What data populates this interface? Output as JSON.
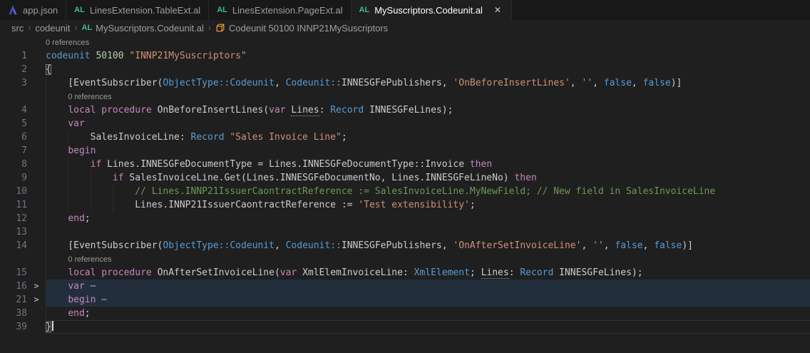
{
  "icons": {
    "al_badge_text": "AL",
    "close_glyph": "✕",
    "chevron_glyph": "›",
    "fold_chevron_glyph": ">"
  },
  "tabs": [
    {
      "label": "app.json",
      "icon": "app-json-icon",
      "active": false
    },
    {
      "label": "LinesExtension.TableExt.al",
      "icon": "al-file-icon",
      "active": false
    },
    {
      "label": "LinesExtension.PageExt.al",
      "icon": "al-file-icon",
      "active": false
    },
    {
      "label": "MySuscriptors.Codeunit.al",
      "icon": "al-file-icon",
      "active": true,
      "close_label": "✕"
    }
  ],
  "breadcrumb": {
    "separator": "›",
    "items": [
      {
        "label": "src"
      },
      {
        "label": "codeunit"
      },
      {
        "label": "MySuscriptors.Codeunit.al",
        "icon": "al-file-icon"
      },
      {
        "label": "Codeunit 50100 INNP21MySuscriptors",
        "icon": "symbol-class-icon"
      }
    ]
  },
  "editor": {
    "codelens_text": "0 references",
    "fold_marker": "⋯",
    "rows": [
      {
        "lens": true,
        "ind": 0
      },
      {
        "n": "1",
        "ind": 0,
        "t": [
          [
            "codeunit",
            "kw"
          ],
          [
            " ",
            "id"
          ],
          [
            "50100",
            "num"
          ],
          [
            " ",
            "id"
          ],
          [
            "\"INNP21MySuscriptors\"",
            "str"
          ]
        ]
      },
      {
        "n": "2",
        "ind": 0,
        "t": [
          [
            "{",
            "bm"
          ]
        ]
      },
      {
        "n": "3",
        "ind": 4,
        "t": [
          [
            "[EventSubscriber(",
            "id"
          ],
          [
            "ObjectType",
            "kw"
          ],
          [
            "::",
            "kw"
          ],
          [
            "Codeunit",
            "kw"
          ],
          [
            ", ",
            "id"
          ],
          [
            "Codeunit",
            "kw"
          ],
          [
            "::",
            "kw"
          ],
          [
            "INNESGFePublishers",
            "id"
          ],
          [
            ", ",
            "id"
          ],
          [
            "'OnBeforeInsertLines'",
            "str"
          ],
          [
            ", ",
            "id"
          ],
          [
            "''",
            "str"
          ],
          [
            ", ",
            "id"
          ],
          [
            "false",
            "kw"
          ],
          [
            ", ",
            "id"
          ],
          [
            "false",
            "kw"
          ],
          [
            ")]",
            "id"
          ]
        ]
      },
      {
        "lens": true,
        "ind": 4
      },
      {
        "n": "4",
        "ind": 4,
        "t": [
          [
            "local",
            "ctrl"
          ],
          [
            " ",
            "id"
          ],
          [
            "procedure",
            "ctrl"
          ],
          [
            " ",
            "id"
          ],
          [
            "OnBeforeInsertLines",
            "id"
          ],
          [
            "(",
            "id"
          ],
          [
            "var",
            "ctrl"
          ],
          [
            " ",
            "id"
          ],
          [
            "Lines",
            "hint"
          ],
          [
            ": ",
            "id"
          ],
          [
            "Record",
            "kw"
          ],
          [
            " INNESGFeLines);",
            "id"
          ]
        ]
      },
      {
        "n": "5",
        "ind": 4,
        "t": [
          [
            "var",
            "ctrl"
          ]
        ]
      },
      {
        "n": "6",
        "ind": 8,
        "t": [
          [
            "SalesInvoiceLine: ",
            "id"
          ],
          [
            "Record",
            "kw"
          ],
          [
            " ",
            "id"
          ],
          [
            "\"Sales Invoice Line\"",
            "str"
          ],
          [
            ";",
            "id"
          ]
        ]
      },
      {
        "n": "7",
        "ind": 4,
        "t": [
          [
            "begin",
            "ctrl"
          ]
        ]
      },
      {
        "n": "8",
        "ind": 8,
        "t": [
          [
            "if",
            "ctrl"
          ],
          [
            " Lines.INNESGFeDocumentType = Lines.INNESGFeDocumentType::Invoice ",
            "id"
          ],
          [
            "then",
            "ctrl"
          ]
        ]
      },
      {
        "n": "9",
        "ind": 12,
        "t": [
          [
            "if",
            "ctrl"
          ],
          [
            " SalesInvoiceLine.Get(Lines.INNESGFeDocumentNo, Lines.INNESGFeLineNo) ",
            "id"
          ],
          [
            "then",
            "ctrl"
          ]
        ]
      },
      {
        "n": "10",
        "ind": 16,
        "t": [
          [
            "// Lines.INNP21IssuerCaontractReference := SalesInvoiceLine.MyNewField; // New field in SalesInvoiceLine",
            "com"
          ]
        ]
      },
      {
        "n": "11",
        "ind": 16,
        "t": [
          [
            "Lines.INNP21IssuerCaontractReference := ",
            "id"
          ],
          [
            "'Test extensibility'",
            "str"
          ],
          [
            ";",
            "id"
          ]
        ]
      },
      {
        "n": "12",
        "ind": 4,
        "t": [
          [
            "end",
            "ctrl"
          ],
          [
            ";",
            "id"
          ]
        ]
      },
      {
        "n": "13",
        "ind": 4,
        "t": []
      },
      {
        "n": "14",
        "ind": 4,
        "t": [
          [
            "[EventSubscriber(",
            "id"
          ],
          [
            "ObjectType",
            "kw"
          ],
          [
            "::",
            "kw"
          ],
          [
            "Codeunit",
            "kw"
          ],
          [
            ", ",
            "id"
          ],
          [
            "Codeunit",
            "kw"
          ],
          [
            "::",
            "kw"
          ],
          [
            "INNESGFePublishers",
            "id"
          ],
          [
            ", ",
            "id"
          ],
          [
            "'OnAfterSetInvoiceLine'",
            "str"
          ],
          [
            ", ",
            "id"
          ],
          [
            "''",
            "str"
          ],
          [
            ", ",
            "id"
          ],
          [
            "false",
            "kw"
          ],
          [
            ", ",
            "id"
          ],
          [
            "false",
            "kw"
          ],
          [
            ")]",
            "id"
          ]
        ]
      },
      {
        "lens": true,
        "ind": 4
      },
      {
        "n": "15",
        "ind": 4,
        "t": [
          [
            "local",
            "ctrl"
          ],
          [
            " ",
            "id"
          ],
          [
            "procedure",
            "ctrl"
          ],
          [
            " ",
            "id"
          ],
          [
            "OnAfterSetInvoiceLine",
            "id"
          ],
          [
            "(",
            "id"
          ],
          [
            "var",
            "ctrl"
          ],
          [
            " ",
            "id"
          ],
          [
            "XmlElemInvoiceLine: ",
            "id"
          ],
          [
            "XmlElement",
            "kw"
          ],
          [
            "; ",
            "id"
          ],
          [
            "Lines",
            "hint"
          ],
          [
            ": ",
            "id"
          ],
          [
            "Record",
            "kw"
          ],
          [
            " INNESGFeLines);",
            "id"
          ]
        ]
      },
      {
        "n": "16",
        "ind": 4,
        "hl": true,
        "chev": true,
        "t": [
          [
            "var",
            "ctrl"
          ],
          [
            " ",
            "id"
          ],
          [
            "⋯",
            "fold"
          ]
        ]
      },
      {
        "n": "21",
        "ind": 4,
        "hl": true,
        "chev": true,
        "t": [
          [
            "begin",
            "ctrl"
          ],
          [
            " ",
            "id"
          ],
          [
            "⋯",
            "fold"
          ]
        ]
      },
      {
        "n": "38",
        "ind": 4,
        "t": [
          [
            "end",
            "ctrl"
          ],
          [
            ";",
            "id"
          ]
        ]
      },
      {
        "n": "39",
        "ind": 0,
        "cur": true,
        "caret": true,
        "t": [
          [
            "}",
            "bm"
          ]
        ]
      }
    ]
  },
  "colors": {
    "editor_bg": "#1f1f1f",
    "tabbar_bg": "#181818",
    "keyword": "#569cd6",
    "control": "#c586c0",
    "string": "#ce9178",
    "number": "#b5cea8",
    "comment": "#6a9955",
    "text": "#cccccc",
    "line_number": "#6e7681",
    "codelens": "#999999",
    "fold_highlight": "#222e3c",
    "al_icon": "#3dbb9f",
    "class_icon": "#ee9d28",
    "app_json_icon": "#6d6af0"
  }
}
